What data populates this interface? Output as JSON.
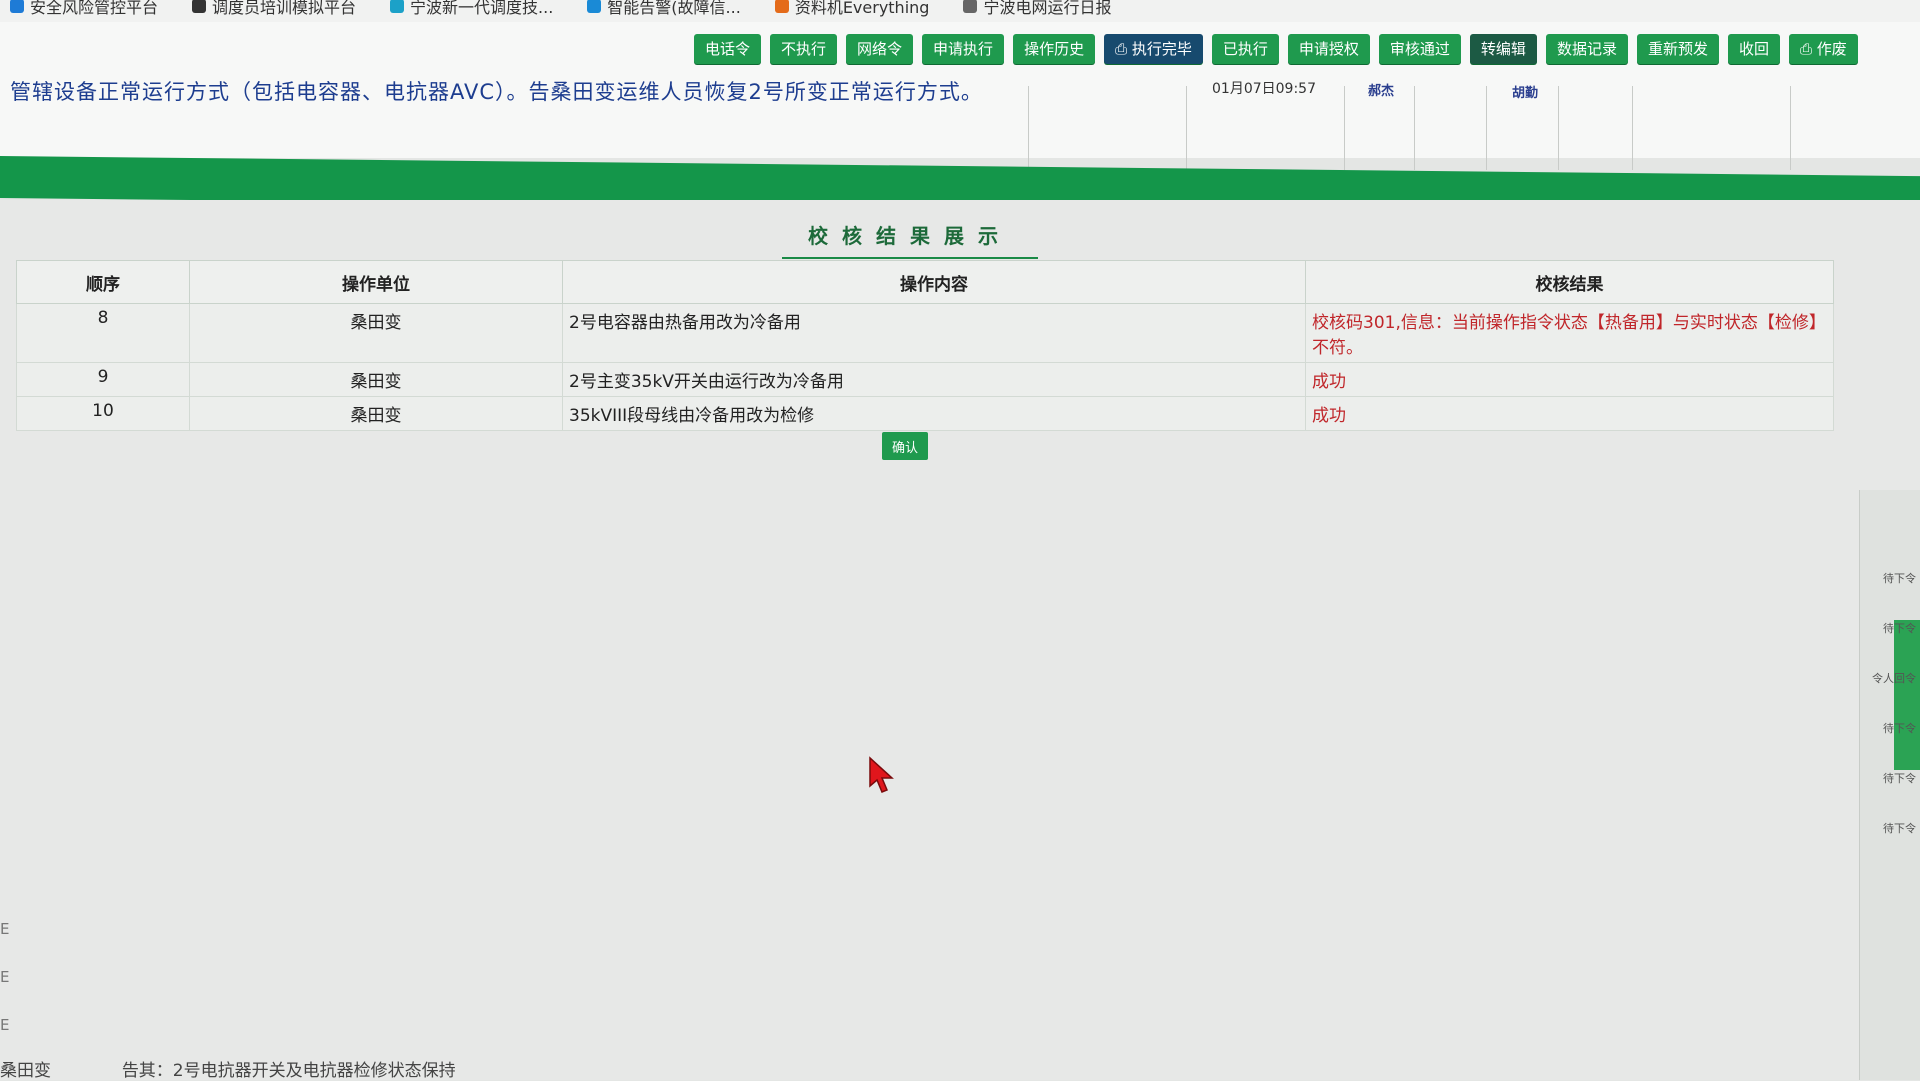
{
  "bookmarks": [
    "安全风险管控平台",
    "调度员培训模拟平台",
    "宁波新一代调度技...",
    "智能告警(故障信...",
    "资料机Everything",
    "宁波电网运行日报"
  ],
  "toolbar": [
    {
      "label": "电话令",
      "style": "green"
    },
    {
      "label": "不执行",
      "style": "green"
    },
    {
      "label": "网络令",
      "style": "green"
    },
    {
      "label": "申请执行",
      "style": "green"
    },
    {
      "label": "操作历史",
      "style": "green"
    },
    {
      "label": "执行完毕",
      "style": "dark"
    },
    {
      "label": "已执行",
      "style": "green"
    },
    {
      "label": "申请授权",
      "style": "green"
    },
    {
      "label": "审核通过",
      "style": "green"
    },
    {
      "label": "转编辑",
      "style": "dark2"
    },
    {
      "label": "数据记录",
      "style": "green"
    },
    {
      "label": "重新预发",
      "style": "green"
    },
    {
      "label": "收回",
      "style": "green"
    },
    {
      "label": "作废",
      "style": "green"
    }
  ],
  "command": {
    "text": "管辖设备正常运行方式（包括电容器、电抗器AVC）。告桑田变运维人员恢复2号所变正常运行方式。",
    "time": "01月07日09:57",
    "operator": "郝杰",
    "reviewer": "胡勤"
  },
  "dialog": {
    "title": "校核结果展示",
    "columns": {
      "seq": "顺序",
      "unit": "操作单位",
      "content": "操作内容",
      "result": "校核结果"
    },
    "rows": [
      {
        "seq": "8",
        "unit": "桑田变",
        "content": "2号电容器由热备用改为冷备用",
        "result": "校核码301,信息：当前操作指令状态【热备用】与实时状态【检修】不符。"
      },
      {
        "seq": "9",
        "unit": "桑田变",
        "content": "2号主变35kV开关由运行改为冷备用",
        "result": "成功"
      },
      {
        "seq": "10",
        "unit": "桑田变",
        "content": "35kVIII段母线由冷备用改为检修",
        "result": "成功"
      }
    ],
    "confirm_label": "确认"
  },
  "side_items": [
    "待下令",
    "待下令",
    "令人回令",
    "待下令",
    "待下令",
    "待下令"
  ],
  "bottom": {
    "unit": "桑田变",
    "text": "告其：2号电抗器开关及电抗器检修状态保持"
  },
  "left_marks": [
    "E",
    "E",
    "E"
  ]
}
